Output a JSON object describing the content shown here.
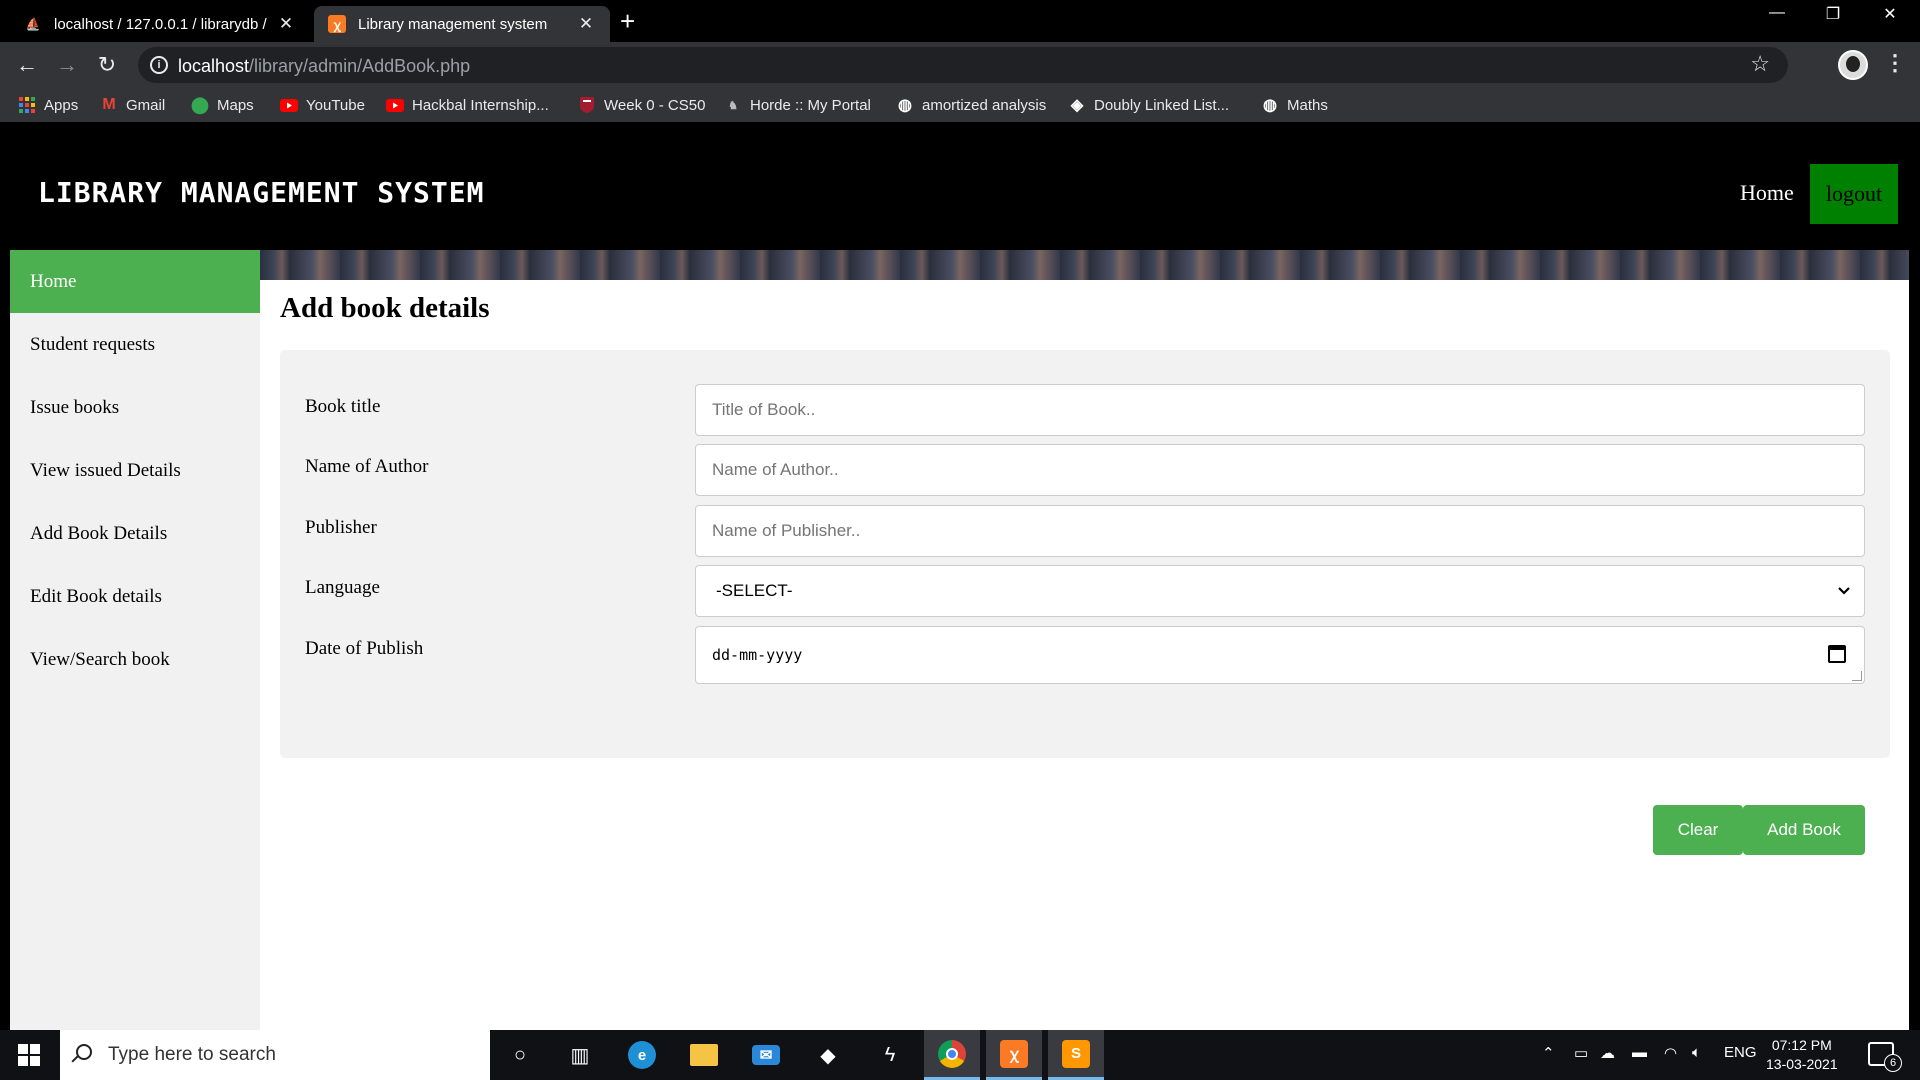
{
  "browser": {
    "tabs": [
      {
        "title": "localhost / 127.0.0.1 / librarydb /",
        "active": false
      },
      {
        "title": "Library management system",
        "active": true
      }
    ],
    "new_tab": "+",
    "address": {
      "host": "localhost",
      "path": "/library/admin/AddBook.php"
    },
    "bookmarks": [
      {
        "label": "Apps",
        "icon": "apps-grid-icon"
      },
      {
        "label": "Gmail",
        "icon": "gmail-icon"
      },
      {
        "label": "Maps",
        "icon": "maps-icon"
      },
      {
        "label": "YouTube",
        "icon": "youtube-icon"
      },
      {
        "label": "Hackbal Internship...",
        "icon": "youtube-icon"
      },
      {
        "label": "Week 0 - CS50",
        "icon": "harvard-icon"
      },
      {
        "label": "Horde :: My Portal",
        "icon": "horde-icon"
      },
      {
        "label": "amortized analysis",
        "icon": "globe-icon"
      },
      {
        "label": "Doubly Linked List...",
        "icon": "site-icon"
      },
      {
        "label": "Maths",
        "icon": "globe-icon"
      }
    ]
  },
  "site": {
    "title": "LIBRARY MANAGEMENT SYSTEM",
    "nav": {
      "home": "Home",
      "logout": "logout"
    }
  },
  "sidebar": {
    "items": [
      {
        "label": "Home",
        "active": true
      },
      {
        "label": "Student requests"
      },
      {
        "label": "Issue books"
      },
      {
        "label": "View issued Details"
      },
      {
        "label": "Add Book Details"
      },
      {
        "label": "Edit Book details"
      },
      {
        "label": "View/Search book"
      }
    ]
  },
  "main": {
    "heading": "Add book details",
    "form": {
      "book_title": {
        "label": "Book title",
        "placeholder": "Title of Book.."
      },
      "author": {
        "label": "Name of Author",
        "placeholder": "Name of Author.."
      },
      "publisher": {
        "label": "Publisher",
        "placeholder": "Name of Publisher.."
      },
      "language": {
        "label": "Language",
        "selected": "-SELECT-"
      },
      "date": {
        "label": "Date of Publish",
        "placeholder": "dd-mm-yyyy"
      },
      "clear_label": "Clear",
      "submit_label": "Add Book"
    }
  },
  "taskbar": {
    "search_placeholder": "Type here to search",
    "language": "ENG",
    "time": "07:12 PM",
    "date": "13-03-2021",
    "notification_count": "6"
  },
  "colors": {
    "accent_green": "#4caf50",
    "logout_green": "#008000",
    "header_black": "#000000",
    "panel_gray": "#f2f2f2"
  }
}
